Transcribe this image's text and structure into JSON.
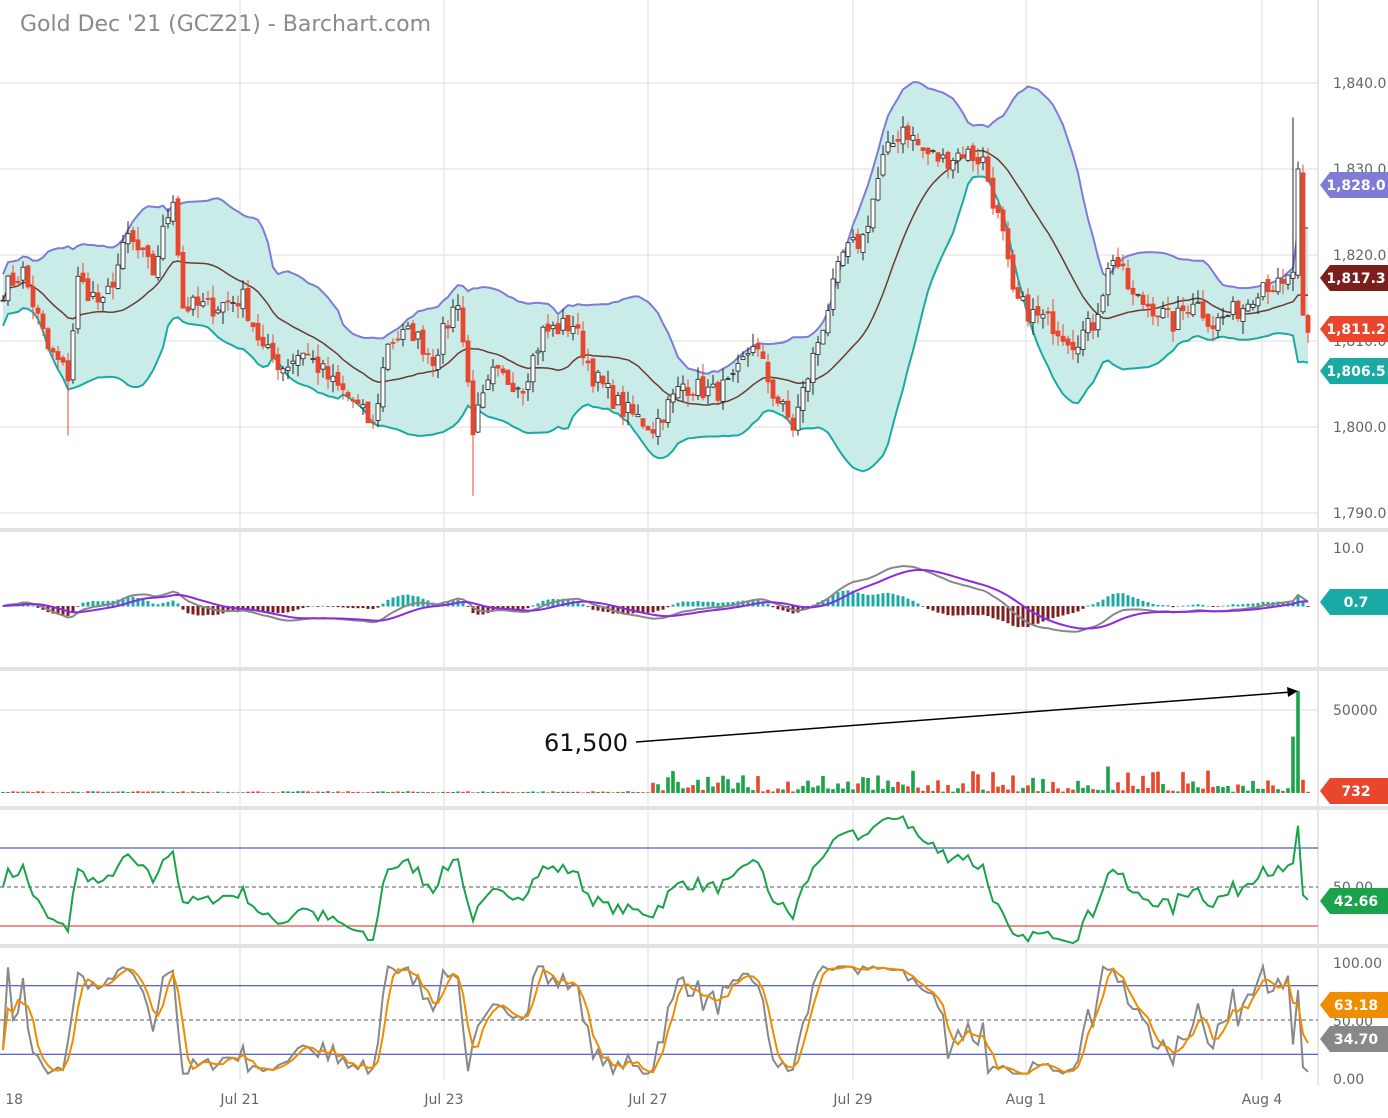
{
  "title": "Gold Dec '21 (GCZ21) - Barchart.com",
  "chart_data": {
    "type": "candlestick",
    "title": "Gold Dec '21 (GCZ21) - Barchart.com",
    "x_ticks": [
      "l 18",
      "Jul 21",
      "Jul 23",
      "Jul 27",
      "Jul 29",
      "Aug 1",
      "Aug 4"
    ],
    "price_axis": {
      "ticks": [
        "1,840.0",
        "1,830.0",
        "1,820.0",
        "1,810.0",
        "1,800.0",
        "1,790.0"
      ],
      "range": [
        1790,
        1840
      ]
    },
    "close_anchors": [
      [
        0,
        1816
      ],
      [
        4,
        1818
      ],
      [
        9,
        1809
      ],
      [
        13,
        1806
      ],
      [
        15,
        1817
      ],
      [
        20,
        1814
      ],
      [
        25,
        1822
      ],
      [
        30,
        1818
      ],
      [
        34,
        1827
      ],
      [
        36,
        1814
      ],
      [
        42,
        1814
      ],
      [
        48,
        1815
      ],
      [
        52,
        1809
      ],
      [
        56,
        1807
      ],
      [
        60,
        1809
      ],
      [
        66,
        1805
      ],
      [
        70,
        1803
      ],
      [
        74,
        1800
      ],
      [
        77,
        1810
      ],
      [
        82,
        1811
      ],
      [
        86,
        1808
      ],
      [
        91,
        1815
      ],
      [
        94,
        1800
      ],
      [
        98,
        1806
      ],
      [
        104,
        1805
      ],
      [
        108,
        1811
      ],
      [
        114,
        1812
      ],
      [
        118,
        1806
      ],
      [
        124,
        1802
      ],
      [
        130,
        1800
      ],
      [
        136,
        1805
      ],
      [
        142,
        1804
      ],
      [
        146,
        1805
      ],
      [
        150,
        1810
      ],
      [
        154,
        1804
      ],
      [
        158,
        1800
      ],
      [
        161,
        1806
      ],
      [
        164,
        1812
      ],
      [
        168,
        1820
      ],
      [
        172,
        1822
      ],
      [
        176,
        1831
      ],
      [
        180,
        1835
      ],
      [
        184,
        1832
      ],
      [
        188,
        1831
      ],
      [
        192,
        1832
      ],
      [
        196,
        1831
      ],
      [
        200,
        1822
      ],
      [
        202,
        1815
      ],
      [
        206,
        1813
      ],
      [
        210,
        1812
      ],
      [
        214,
        1810
      ],
      [
        218,
        1812
      ],
      [
        222,
        1820
      ],
      [
        226,
        1815
      ],
      [
        230,
        1814
      ],
      [
        234,
        1812
      ],
      [
        238,
        1815
      ],
      [
        242,
        1812
      ],
      [
        248,
        1814
      ],
      [
        252,
        1817
      ],
      [
        256,
        1816
      ],
      [
        258,
        1818
      ],
      [
        259,
        1830
      ],
      [
        260,
        1813
      ],
      [
        261,
        1811
      ]
    ],
    "last_values": {
      "bb_upper": "1,828.0",
      "bb_middle": "1,817.3",
      "last_price": "1,811.2",
      "bb_lower": "1,806.5"
    },
    "macd": {
      "ticks": [
        "10.0"
      ],
      "last": "0.7"
    },
    "volume": {
      "ticks": [
        "50000"
      ],
      "last": "732",
      "annotation": "61,500",
      "peak": 61500
    },
    "rsi": {
      "ticks": [
        "50.00"
      ],
      "last": "42.66",
      "overbought": 70,
      "oversold": 30
    },
    "stochastic": {
      "ticks": [
        "100.00",
        "50.00",
        "0.00"
      ],
      "k_last": "63.18",
      "d_last": "34.70"
    },
    "colors": {
      "up": "#1aa34a",
      "down": "#e8472e",
      "band_fill": "#c9ece9",
      "band_upper": "#7f7bd6",
      "band_lower": "#1aaaa5",
      "ma": "#6b3a30",
      "macd_line": "#8a2be2",
      "signal": "#888888",
      "rsi": "#1aa34a",
      "stoch_k": "#888888",
      "stoch_d": "#f08c00"
    }
  }
}
